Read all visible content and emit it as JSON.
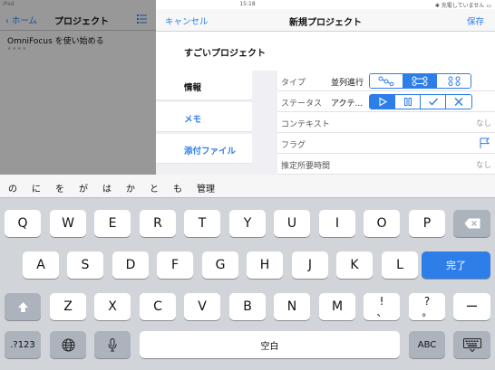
{
  "status_bar": {
    "device": "iPad",
    "time": "15:18",
    "battery": "充電していません"
  },
  "background": {
    "back_label": "ホーム",
    "title": "プロジェクト",
    "item_title": "OmniFocus を使い始める",
    "item_rating": "★★★★"
  },
  "modal": {
    "cancel_label": "キャンセル",
    "title": "新規プロジェクト",
    "save_label": "保存",
    "project_name": "すごいプロジェクト",
    "sidebar": [
      {
        "label": "情報",
        "active": true
      },
      {
        "label": "メモ",
        "active": false
      },
      {
        "label": "添付ファイル",
        "active": false
      }
    ],
    "fields": {
      "type": {
        "label": "タイプ",
        "value": "並列進行",
        "options": [
          "sequential-icon",
          "parallel-icon",
          "single-actions-icon"
        ],
        "selected": 1
      },
      "status": {
        "label": "ステータス",
        "value": "アクテ...",
        "options": [
          "active-icon",
          "on-hold-icon",
          "completed-icon",
          "dropped-icon"
        ],
        "selected": 0
      },
      "context": {
        "label": "コンテキスト",
        "value": "なし"
      },
      "flag": {
        "label": "フラグ"
      },
      "estimate": {
        "label": "推定所要時間",
        "value": "なし"
      }
    }
  },
  "keyboard": {
    "candidates": [
      "の",
      "に",
      "を",
      "が",
      "は",
      "か",
      "と",
      "も",
      "管理"
    ],
    "row1": [
      "Q",
      "W",
      "E",
      "R",
      "T",
      "Y",
      "U",
      "I",
      "O",
      "P"
    ],
    "row2": [
      "A",
      "S",
      "D",
      "F",
      "G",
      "H",
      "J",
      "K",
      "L"
    ],
    "row3": [
      "Z",
      "X",
      "C",
      "V",
      "B",
      "N",
      "M"
    ],
    "key_excl_top": "!",
    "key_excl_bottom": "、",
    "key_q_top": "?",
    "key_q_bottom": "。",
    "key_dash": "ー",
    "done_label": "完了",
    "numbers_label": ".?123",
    "space_label": "空白",
    "abc_label": "ABC",
    "accent_color": "#2d7ee8"
  }
}
